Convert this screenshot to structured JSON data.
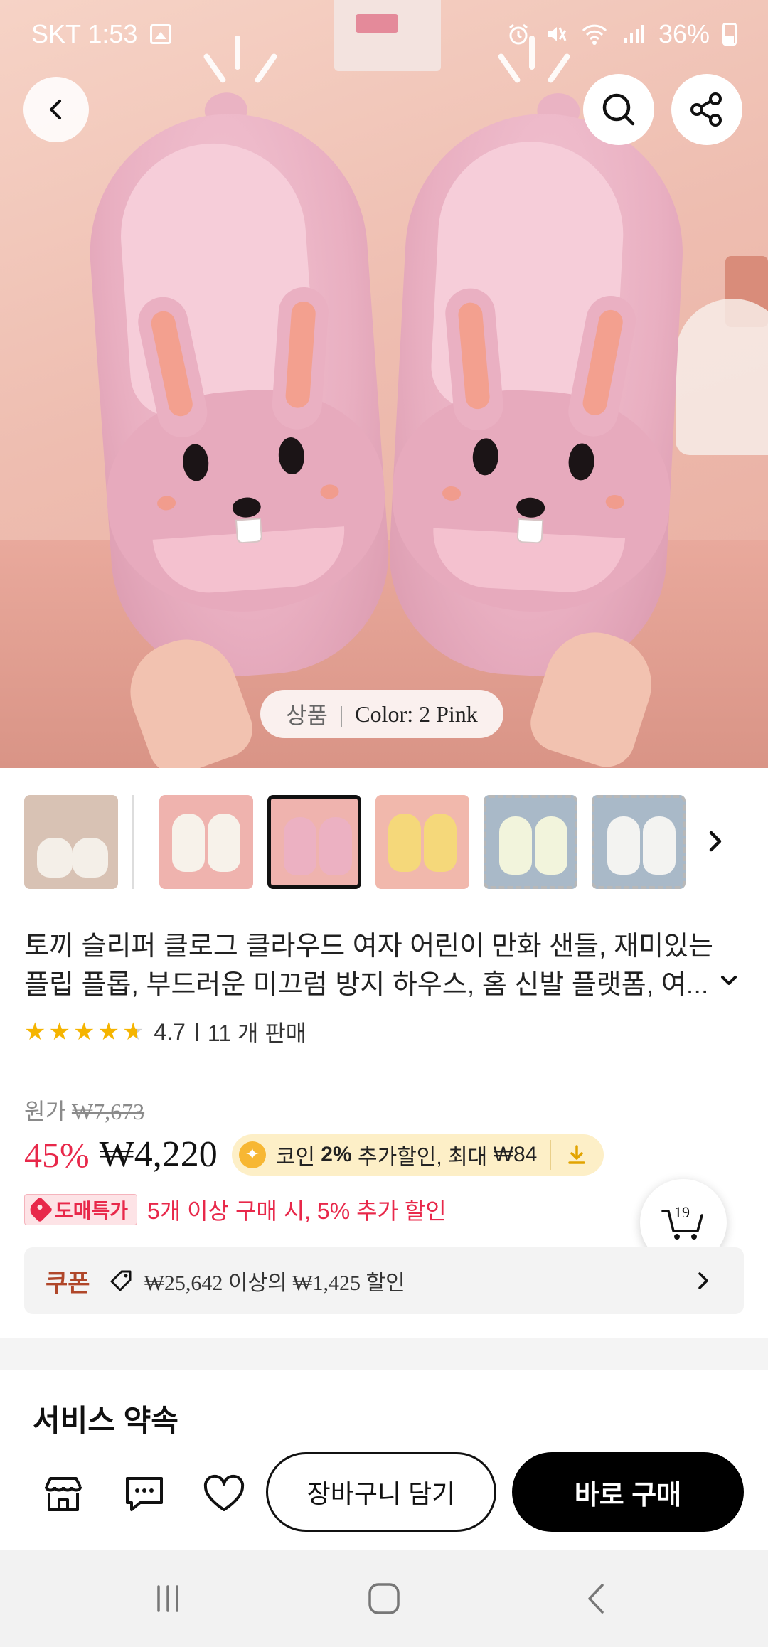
{
  "status_bar": {
    "carrier_time": "SKT 1:53",
    "battery": "36%"
  },
  "hero": {
    "variant_prefix": "상품",
    "variant_sep": "|",
    "variant_label": "Color: 2 Pink"
  },
  "thumbnails": [
    {
      "name": "thumb-main-photo",
      "colors": [
        "#f4efe8",
        "#f4efe8"
      ],
      "bg": "#d8c2b4",
      "state": "normal"
    },
    {
      "name": "thumb-white",
      "colors": [
        "#f7f2ea",
        "#f7f2ea"
      ],
      "bg": "#efb3ae",
      "state": "normal"
    },
    {
      "name": "thumb-pink",
      "colors": [
        "#ecb1c2",
        "#ecb1c2"
      ],
      "bg": "#efb3ae",
      "state": "selected"
    },
    {
      "name": "thumb-yellow",
      "colors": [
        "#f5d87a",
        "#f5d87a"
      ],
      "bg": "#f1b8ac",
      "state": "normal"
    },
    {
      "name": "thumb-cream-bear",
      "colors": [
        "#f2f4dc",
        "#f2f4dc"
      ],
      "bg": "#a9b9c8",
      "state": "dashed"
    },
    {
      "name": "thumb-white-bear",
      "colors": [
        "#f3f3f1",
        "#f3f3f1"
      ],
      "bg": "#a9b9c8",
      "state": "dashed"
    }
  ],
  "product": {
    "title": "토끼 슬리퍼 클로그 클라우드 여자 어린이 만화 샌들, 재미있는 플립 플롭, 부드러운 미끄럼 방지 하우스, 홈 신발 플랫폼, 여...",
    "rating_value": 4.7,
    "rating_text": "4.7",
    "sold_text": "11 개 판매"
  },
  "price": {
    "original_label": "원가",
    "original_price": "₩7,673",
    "discount": "45%",
    "current_price": "₩4,220",
    "coin_text_1": "코인",
    "coin_percent": "2%",
    "coin_text_2": "추가할인, 최대",
    "coin_max": "₩84"
  },
  "bulk": {
    "badge": "도매특가",
    "text": "5개 이상 구매 시, 5% 추가 할인"
  },
  "cart": {
    "count": "19"
  },
  "coupon": {
    "label": "쿠폰",
    "text": "₩25,642 이상의 ₩1,425 할인"
  },
  "service": {
    "title": "서비스 약속"
  },
  "actions": {
    "add_to_cart": "장바구니 담기",
    "buy_now": "바로 구매"
  },
  "colors": {
    "accent_red": "#e8284a",
    "coupon_brown": "#b0472a",
    "star_gold": "#f5b400",
    "buy_black": "#000000"
  }
}
